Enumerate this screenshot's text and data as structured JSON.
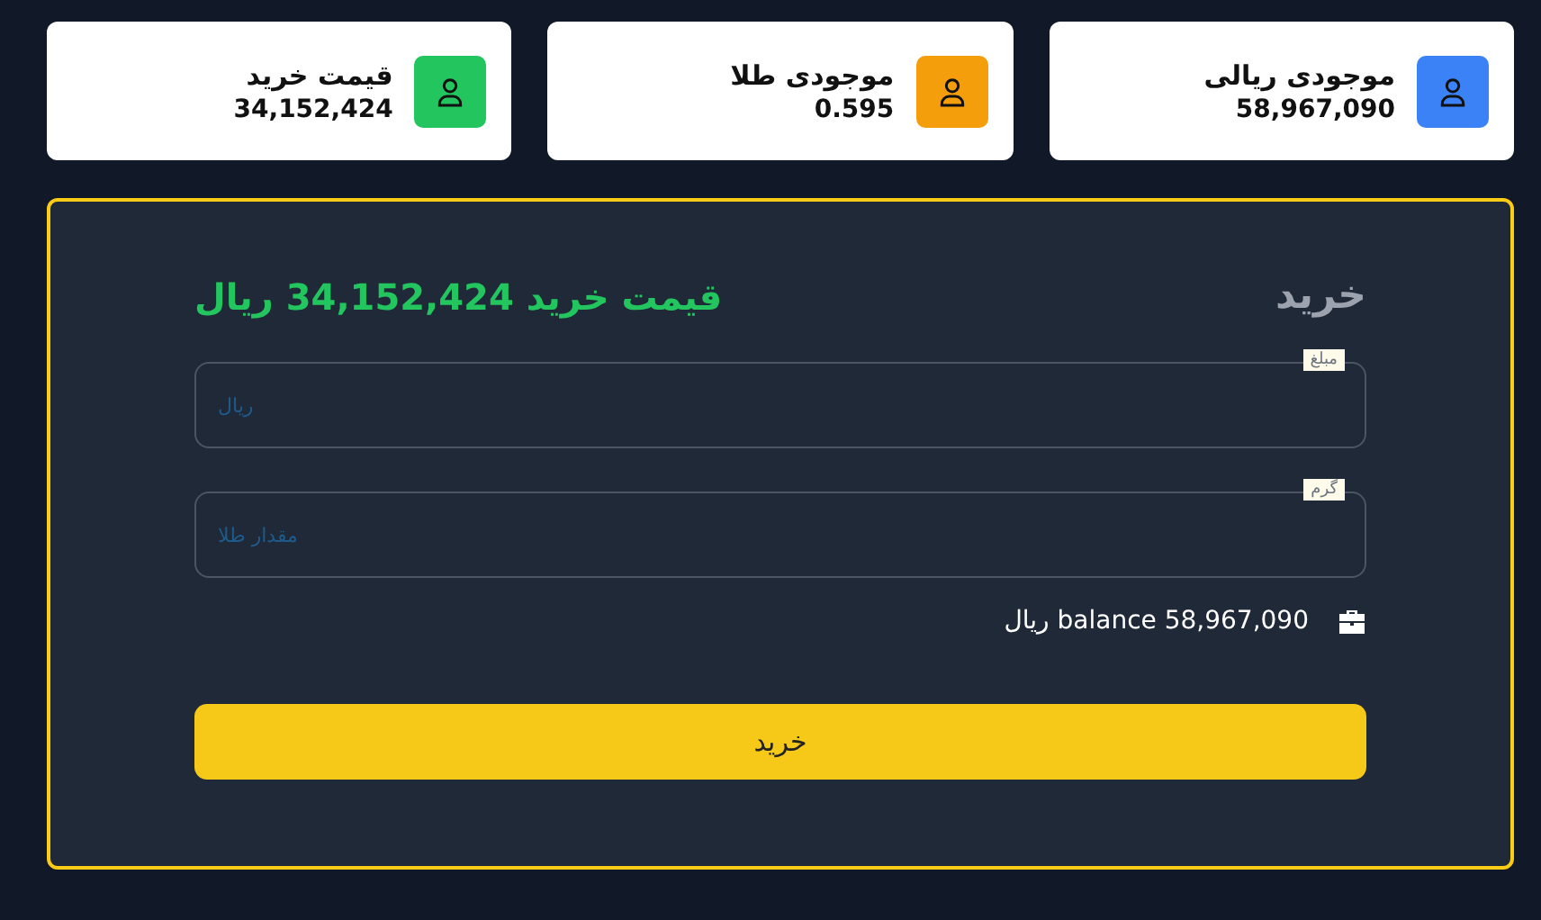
{
  "cards": [
    {
      "title": "موجودی ریالی",
      "value": "58,967,090",
      "color": "#3b82f6"
    },
    {
      "title": "موجودی طلا",
      "value": "0.595",
      "color": "#f59e0b"
    },
    {
      "title": "قیمت خرید",
      "value": "34,152,424",
      "color": "#22c55e"
    }
  ],
  "form": {
    "title": "خرید",
    "price": "قیمت خرید 34,152,424 ریال",
    "fields": [
      {
        "label": "مبلغ",
        "placeholder": "ریال"
      },
      {
        "label": "گرم",
        "placeholder": "مقدار طلا"
      }
    ],
    "balance": "balance 58,967,090 ریال",
    "submit": "خرید"
  }
}
